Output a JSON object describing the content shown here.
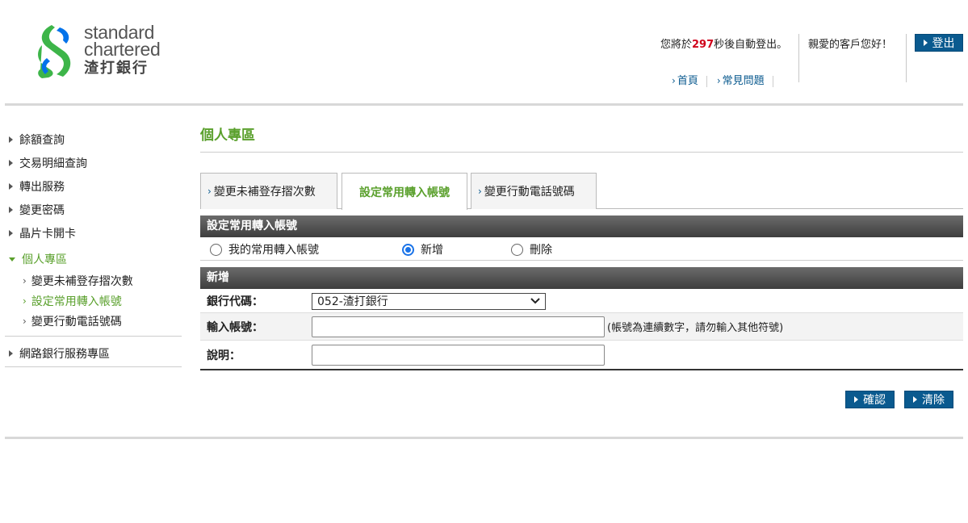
{
  "brand": {
    "name_en_line1": "standard",
    "name_en_line2": "chartered",
    "name_zh": "渣打銀行",
    "colors": {
      "green": "#3db549",
      "blue": "#0473ea",
      "accent_green": "#5aa02c",
      "button_blue": "#0a5a8f"
    }
  },
  "header": {
    "timer_prefix": "您將於",
    "timer_seconds": "297",
    "timer_suffix": "秒後自動登出。",
    "greeting": "親愛的客戶您好！",
    "logout_label": "登出",
    "links": [
      {
        "label": "首頁"
      },
      {
        "label": "常見問題"
      }
    ]
  },
  "sidebar": {
    "items": [
      {
        "label": "餘額查詢"
      },
      {
        "label": "交易明細查詢"
      },
      {
        "label": "轉出服務"
      },
      {
        "label": "變更密碼"
      },
      {
        "label": "晶片卡開卡"
      },
      {
        "label": "個人專區"
      }
    ],
    "sub_items": [
      {
        "label": "變更未補登存摺次數"
      },
      {
        "label": "設定常用轉入帳號"
      },
      {
        "label": "變更行動電話號碼"
      }
    ],
    "extra_item": {
      "label": "網路銀行服務專區"
    }
  },
  "main": {
    "page_title": "個人專區",
    "tabs": [
      {
        "label": "變更未補登存摺次數"
      },
      {
        "label": "設定常用轉入帳號"
      },
      {
        "label": "變更行動電話號碼"
      }
    ],
    "section_title": "設定常用轉入帳號",
    "radios": [
      {
        "label": "我的常用轉入帳號",
        "checked": false
      },
      {
        "label": "新增",
        "checked": true
      },
      {
        "label": "刪除",
        "checked": false
      }
    ],
    "form_title": "新增",
    "form": {
      "bank_code_label": "銀行代碼：",
      "bank_code_value": "052-渣打銀行",
      "account_label": "輸入帳號：",
      "account_value": "",
      "account_hint": "(帳號為連續數字，請勿輸入其他符號)",
      "memo_label": "說明：",
      "memo_value": ""
    },
    "confirm_label": "確認",
    "clear_label": "清除"
  }
}
